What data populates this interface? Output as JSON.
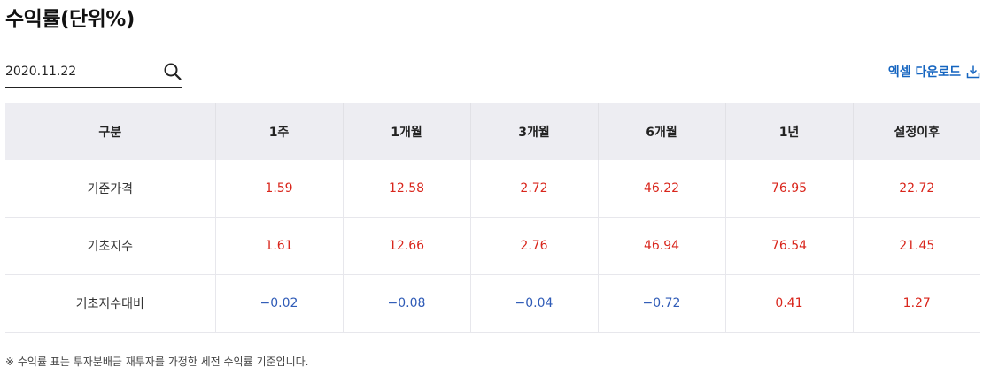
{
  "page_title": "수익률(단위%)",
  "date_search": {
    "value": "2020.11.22",
    "icon": "search-icon"
  },
  "excel_download": {
    "label": "엑셀 다운로드",
    "icon": "download-icon"
  },
  "table": {
    "headers": [
      "구분",
      "1주",
      "1개월",
      "3개월",
      "6개월",
      "1년",
      "설정이후"
    ],
    "rows": [
      {
        "label": "기준가격",
        "values": [
          "1.59",
          "12.58",
          "2.72",
          "46.22",
          "76.95",
          "22.72"
        ]
      },
      {
        "label": "기초지수",
        "values": [
          "1.61",
          "12.66",
          "2.76",
          "46.94",
          "76.54",
          "21.45"
        ]
      },
      {
        "label": "기초지수대비",
        "values": [
          "−0.02",
          "−0.08",
          "−0.04",
          "−0.72",
          "0.41",
          "1.27"
        ]
      }
    ]
  },
  "colors": {
    "positive": "#d9261c",
    "negative": "#2f5bb7",
    "link": "#1565c0",
    "header_bg": "#ededf2"
  },
  "footnote": "※ 수익률 표는 투자분배금 재투자를 가정한 세전 수익률 기준입니다."
}
